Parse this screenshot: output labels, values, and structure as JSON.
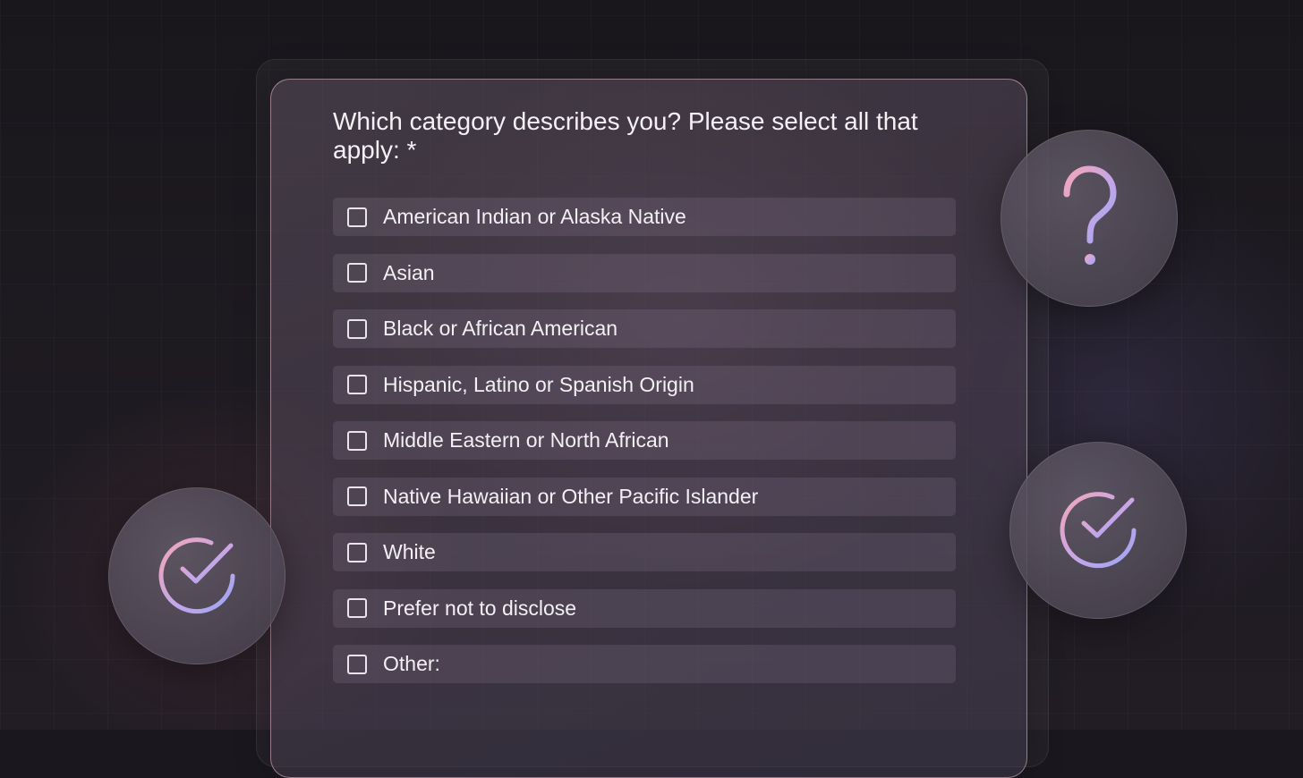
{
  "form": {
    "question": "Which category describes you? Please select all that apply: *",
    "options": [
      {
        "label": "American Indian or Alaska Native",
        "checked": false
      },
      {
        "label": "Asian",
        "checked": false
      },
      {
        "label": "Black or African American",
        "checked": false
      },
      {
        "label": "Hispanic, Latino or Spanish Origin",
        "checked": false
      },
      {
        "label": "Middle Eastern or North African",
        "checked": false
      },
      {
        "label": "Native Hawaiian or Other Pacific Islander",
        "checked": false
      },
      {
        "label": "White",
        "checked": false
      },
      {
        "label": "Prefer not to disclose",
        "checked": false
      },
      {
        "label": "Other:",
        "checked": false
      }
    ]
  },
  "decorations": {
    "question_badge_icon": "question-mark-icon",
    "check_badge_icon": "check-circle-icon",
    "gradient_colors": [
      "#f2a6b8",
      "#c6a6e8",
      "#9aa6f2"
    ]
  }
}
